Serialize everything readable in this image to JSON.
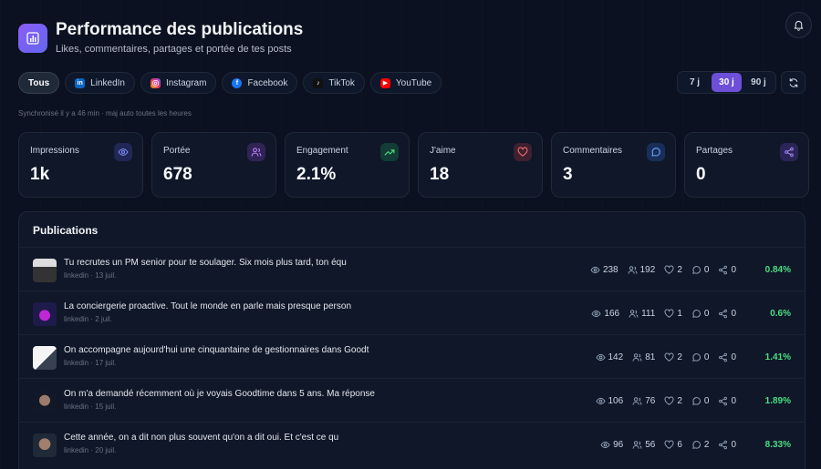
{
  "header": {
    "title": "Performance des publications",
    "subtitle": "Likes, commentaires, partages et portée de tes posts"
  },
  "filters": [
    {
      "label": "Tous",
      "icon": "",
      "color": ""
    },
    {
      "label": "LinkedIn",
      "icon": "linkedin-icon",
      "color": "#0a66c2"
    },
    {
      "label": "Instagram",
      "icon": "instagram-icon",
      "color": "#e1306c"
    },
    {
      "label": "Facebook",
      "icon": "facebook-icon",
      "color": "#1877f2"
    },
    {
      "label": "TikTok",
      "icon": "tiktok-icon",
      "color": "#111111"
    },
    {
      "label": "YouTube",
      "icon": "youtube-icon",
      "color": "#ff0000"
    }
  ],
  "periods": [
    "7 j",
    "30 j",
    "90 j"
  ],
  "active_period": "30 j",
  "sync_text": "Synchronisé il y a 46 min · maj auto toutes les heures",
  "stats": [
    {
      "label": "Impressions",
      "value": "1k",
      "icon": "eye-icon",
      "color": "#6366f1"
    },
    {
      "label": "Portée",
      "value": "678",
      "icon": "users-icon",
      "color": "#a855f7"
    },
    {
      "label": "Engagement",
      "value": "2.1%",
      "icon": "trend-up-icon",
      "color": "#22c55e"
    },
    {
      "label": "J'aime",
      "value": "18",
      "icon": "heart-icon",
      "color": "#ef4444"
    },
    {
      "label": "Commentaires",
      "value": "3",
      "icon": "comment-icon",
      "color": "#3b82f6"
    },
    {
      "label": "Partages",
      "value": "0",
      "icon": "share-icon",
      "color": "#8b5cf6"
    }
  ],
  "publications": {
    "title": "Publications",
    "rows": [
      {
        "text": "Tu recrutes un PM senior pour te soulager. Six mois plus tard, ton équ",
        "platform": "linkedin",
        "date": "13 juil.",
        "views": "238",
        "reach": "192",
        "likes": "2",
        "comments": "0",
        "shares": "0",
        "rate": "0.84%"
      },
      {
        "text": "La conciergerie proactive. Tout le monde en parle mais presque person",
        "platform": "linkedin",
        "date": "2 juil.",
        "views": "166",
        "reach": "111",
        "likes": "1",
        "comments": "0",
        "shares": "0",
        "rate": "0.6%"
      },
      {
        "text": "On accompagne aujourd'hui une cinquantaine de gestionnaires dans Goodt",
        "platform": "linkedin",
        "date": "17 juil.",
        "views": "142",
        "reach": "81",
        "likes": "2",
        "comments": "0",
        "shares": "0",
        "rate": "1.41%"
      },
      {
        "text": "On m'a demandé récemment où je voyais Goodtime dans 5 ans. Ma réponse",
        "platform": "linkedin",
        "date": "15 juil.",
        "views": "106",
        "reach": "76",
        "likes": "2",
        "comments": "0",
        "shares": "0",
        "rate": "1.89%"
      },
      {
        "text": "Cette année, on a dit non plus souvent qu'on a dit oui. Et c'est ce qu",
        "platform": "linkedin",
        "date": "20 juil.",
        "views": "96",
        "reach": "56",
        "likes": "6",
        "comments": "2",
        "shares": "0",
        "rate": "8.33%"
      }
    ]
  }
}
